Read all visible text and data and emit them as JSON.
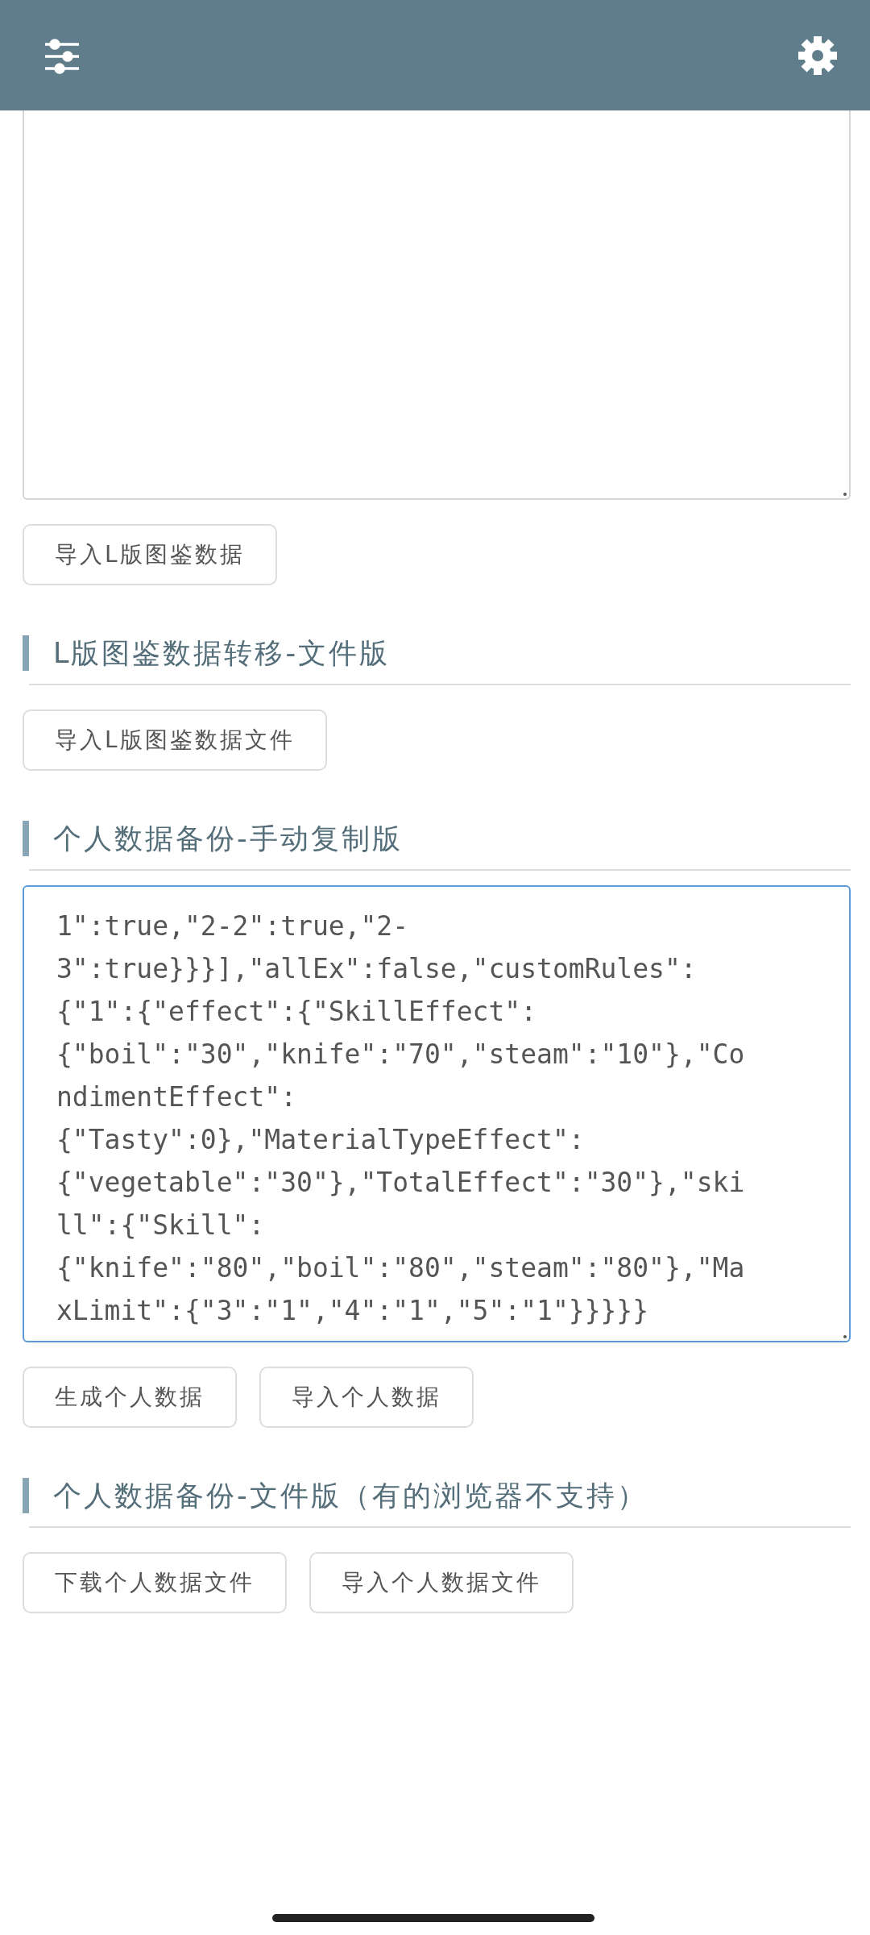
{
  "top_bar": {
    "kind": "app-bar"
  },
  "blocks": [
    {
      "kind": "textarea",
      "focused": false
    },
    {
      "kind": "buttons",
      "buttons": [
        "导入L版图鉴数据"
      ]
    },
    {
      "kind": "heading",
      "text": "L版图鉴数据转移-文件版"
    },
    {
      "kind": "buttons",
      "buttons": [
        "导入L版图鉴数据文件"
      ]
    },
    {
      "kind": "heading",
      "text": "个人数据备份-手动复制版"
    },
    {
      "kind": "textarea",
      "focused": true,
      "value_lines": [
        "1\":true,\"2-2\":true,\"2-",
        "3\":true}}}],\"allEx\":false,\"customRules\":",
        "{\"1\":{\"effect\":{\"SkillEffect\":",
        "{\"boil\":\"30\",\"knife\":\"70\",\"steam\":\"10\"},\"Co",
        "ndimentEffect\":",
        "{\"Tasty\":0},\"MaterialTypeEffect\":",
        "{\"vegetable\":\"30\"},\"TotalEffect\":\"30\"},\"ski",
        "ll\":{\"Skill\":",
        "{\"knife\":\"80\",\"boil\":\"80\",\"steam\":\"80\"},\"Ma",
        "xLimit\":{\"3\":\"1\",\"4\":\"1\",\"5\":\"1\"}}}}}"
      ]
    },
    {
      "kind": "buttons",
      "buttons": [
        "生成个人数据",
        "导入个人数据"
      ]
    },
    {
      "kind": "heading",
      "text": "个人数据备份-文件版（有的浏览器不支持）"
    },
    {
      "kind": "buttons",
      "buttons": [
        "下载个人数据文件",
        "导入个人数据文件"
      ]
    }
  ]
}
